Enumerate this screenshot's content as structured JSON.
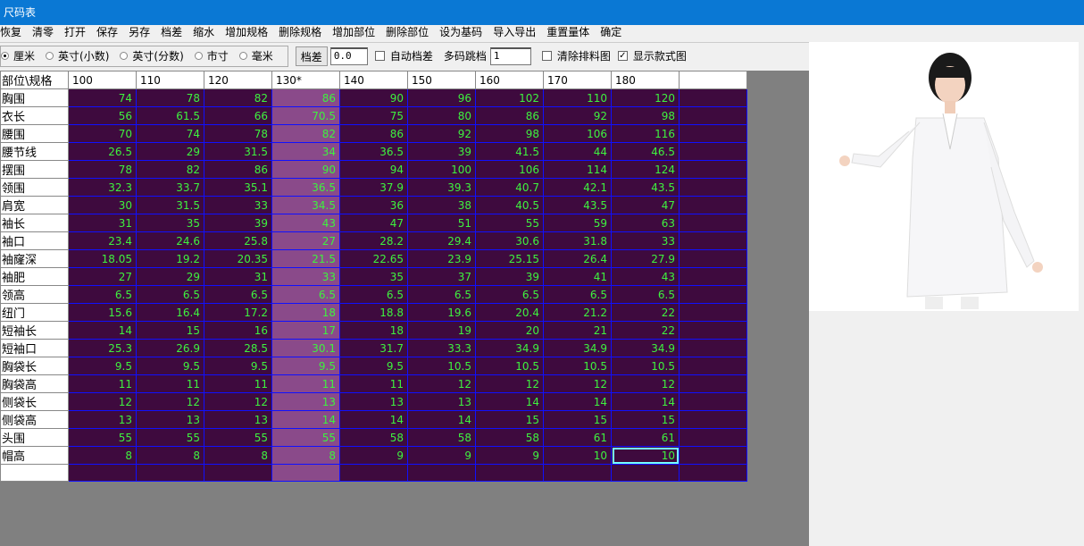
{
  "window": {
    "title": "尺码表"
  },
  "menu": [
    "恢复",
    "清零",
    "打开",
    "保存",
    "另存",
    "档差",
    "缩水",
    "增加规格",
    "删除规格",
    "增加部位",
    "删除部位",
    "设为基码",
    "导入导出",
    "重置量体",
    "确定"
  ],
  "toolbar": {
    "units": [
      {
        "label": "厘米",
        "checked": true
      },
      {
        "label": "英寸(小数)",
        "checked": false
      },
      {
        "label": "英寸(分数)",
        "checked": false
      },
      {
        "label": "市寸",
        "checked": false
      },
      {
        "label": "毫米",
        "checked": false
      }
    ],
    "grade_button": "档差",
    "grade_value": "0.0",
    "auto_grade": {
      "label": "自动档差",
      "checked": false
    },
    "multi_jump_label": "多码跳档",
    "multi_jump_value": "1",
    "clear_marker": {
      "label": "清除排料图",
      "checked": false
    },
    "show_style": {
      "label": "显示款式图",
      "checked": true
    }
  },
  "grid": {
    "corner": "部位\\规格",
    "sizes": [
      "100",
      "110",
      "120",
      "130*",
      "140",
      "150",
      "160",
      "170",
      "180"
    ],
    "base_index": 3,
    "rows": [
      {
        "part": "胸围",
        "values": [
          "74",
          "78",
          "82",
          "86",
          "90",
          "96",
          "102",
          "110",
          "120"
        ]
      },
      {
        "part": "衣长",
        "values": [
          "56",
          "61.5",
          "66",
          "70.5",
          "75",
          "80",
          "86",
          "92",
          "98"
        ]
      },
      {
        "part": "腰围",
        "values": [
          "70",
          "74",
          "78",
          "82",
          "86",
          "92",
          "98",
          "106",
          "116"
        ]
      },
      {
        "part": "腰节线",
        "values": [
          "26.5",
          "29",
          "31.5",
          "34",
          "36.5",
          "39",
          "41.5",
          "44",
          "46.5"
        ]
      },
      {
        "part": "摆围",
        "values": [
          "78",
          "82",
          "86",
          "90",
          "94",
          "100",
          "106",
          "114",
          "124"
        ]
      },
      {
        "part": "领围",
        "values": [
          "32.3",
          "33.7",
          "35.1",
          "36.5",
          "37.9",
          "39.3",
          "40.7",
          "42.1",
          "43.5"
        ]
      },
      {
        "part": "肩宽",
        "values": [
          "30",
          "31.5",
          "33",
          "34.5",
          "36",
          "38",
          "40.5",
          "43.5",
          "47"
        ]
      },
      {
        "part": "袖长",
        "values": [
          "31",
          "35",
          "39",
          "43",
          "47",
          "51",
          "55",
          "59",
          "63"
        ]
      },
      {
        "part": "袖口",
        "values": [
          "23.4",
          "24.6",
          "25.8",
          "27",
          "28.2",
          "29.4",
          "30.6",
          "31.8",
          "33"
        ]
      },
      {
        "part": "袖窿深",
        "values": [
          "18.05",
          "19.2",
          "20.35",
          "21.5",
          "22.65",
          "23.9",
          "25.15",
          "26.4",
          "27.9"
        ]
      },
      {
        "part": "袖肥",
        "values": [
          "27",
          "29",
          "31",
          "33",
          "35",
          "37",
          "39",
          "41",
          "43"
        ]
      },
      {
        "part": "领高",
        "values": [
          "6.5",
          "6.5",
          "6.5",
          "6.5",
          "6.5",
          "6.5",
          "6.5",
          "6.5",
          "6.5"
        ]
      },
      {
        "part": "纽门",
        "values": [
          "15.6",
          "16.4",
          "17.2",
          "18",
          "18.8",
          "19.6",
          "20.4",
          "21.2",
          "22"
        ]
      },
      {
        "part": "短袖长",
        "values": [
          "14",
          "15",
          "16",
          "17",
          "18",
          "19",
          "20",
          "21",
          "22"
        ]
      },
      {
        "part": "短袖口",
        "values": [
          "25.3",
          "26.9",
          "28.5",
          "30.1",
          "31.7",
          "33.3",
          "34.9",
          "34.9",
          "34.9"
        ]
      },
      {
        "part": "胸袋长",
        "values": [
          "9.5",
          "9.5",
          "9.5",
          "9.5",
          "9.5",
          "10.5",
          "10.5",
          "10.5",
          "10.5"
        ]
      },
      {
        "part": "胸袋高",
        "values": [
          "11",
          "11",
          "11",
          "11",
          "11",
          "12",
          "12",
          "12",
          "12"
        ]
      },
      {
        "part": "侧袋长",
        "values": [
          "12",
          "12",
          "12",
          "13",
          "13",
          "13",
          "14",
          "14",
          "14"
        ]
      },
      {
        "part": "侧袋高",
        "values": [
          "13",
          "13",
          "13",
          "14",
          "14",
          "14",
          "15",
          "15",
          "15"
        ]
      },
      {
        "part": "头围",
        "values": [
          "55",
          "55",
          "55",
          "55",
          "58",
          "58",
          "58",
          "61",
          "61"
        ]
      },
      {
        "part": "帽高",
        "values": [
          "8",
          "8",
          "8",
          "8",
          "9",
          "9",
          "9",
          "10",
          "10"
        ]
      }
    ]
  },
  "colors": {
    "cell_bg": "#3e0a3e",
    "base_bg": "#8a4a8a",
    "value_text": "#3ef23e",
    "grid_line": "#1010ff",
    "title_bar": "#0a78d4"
  }
}
